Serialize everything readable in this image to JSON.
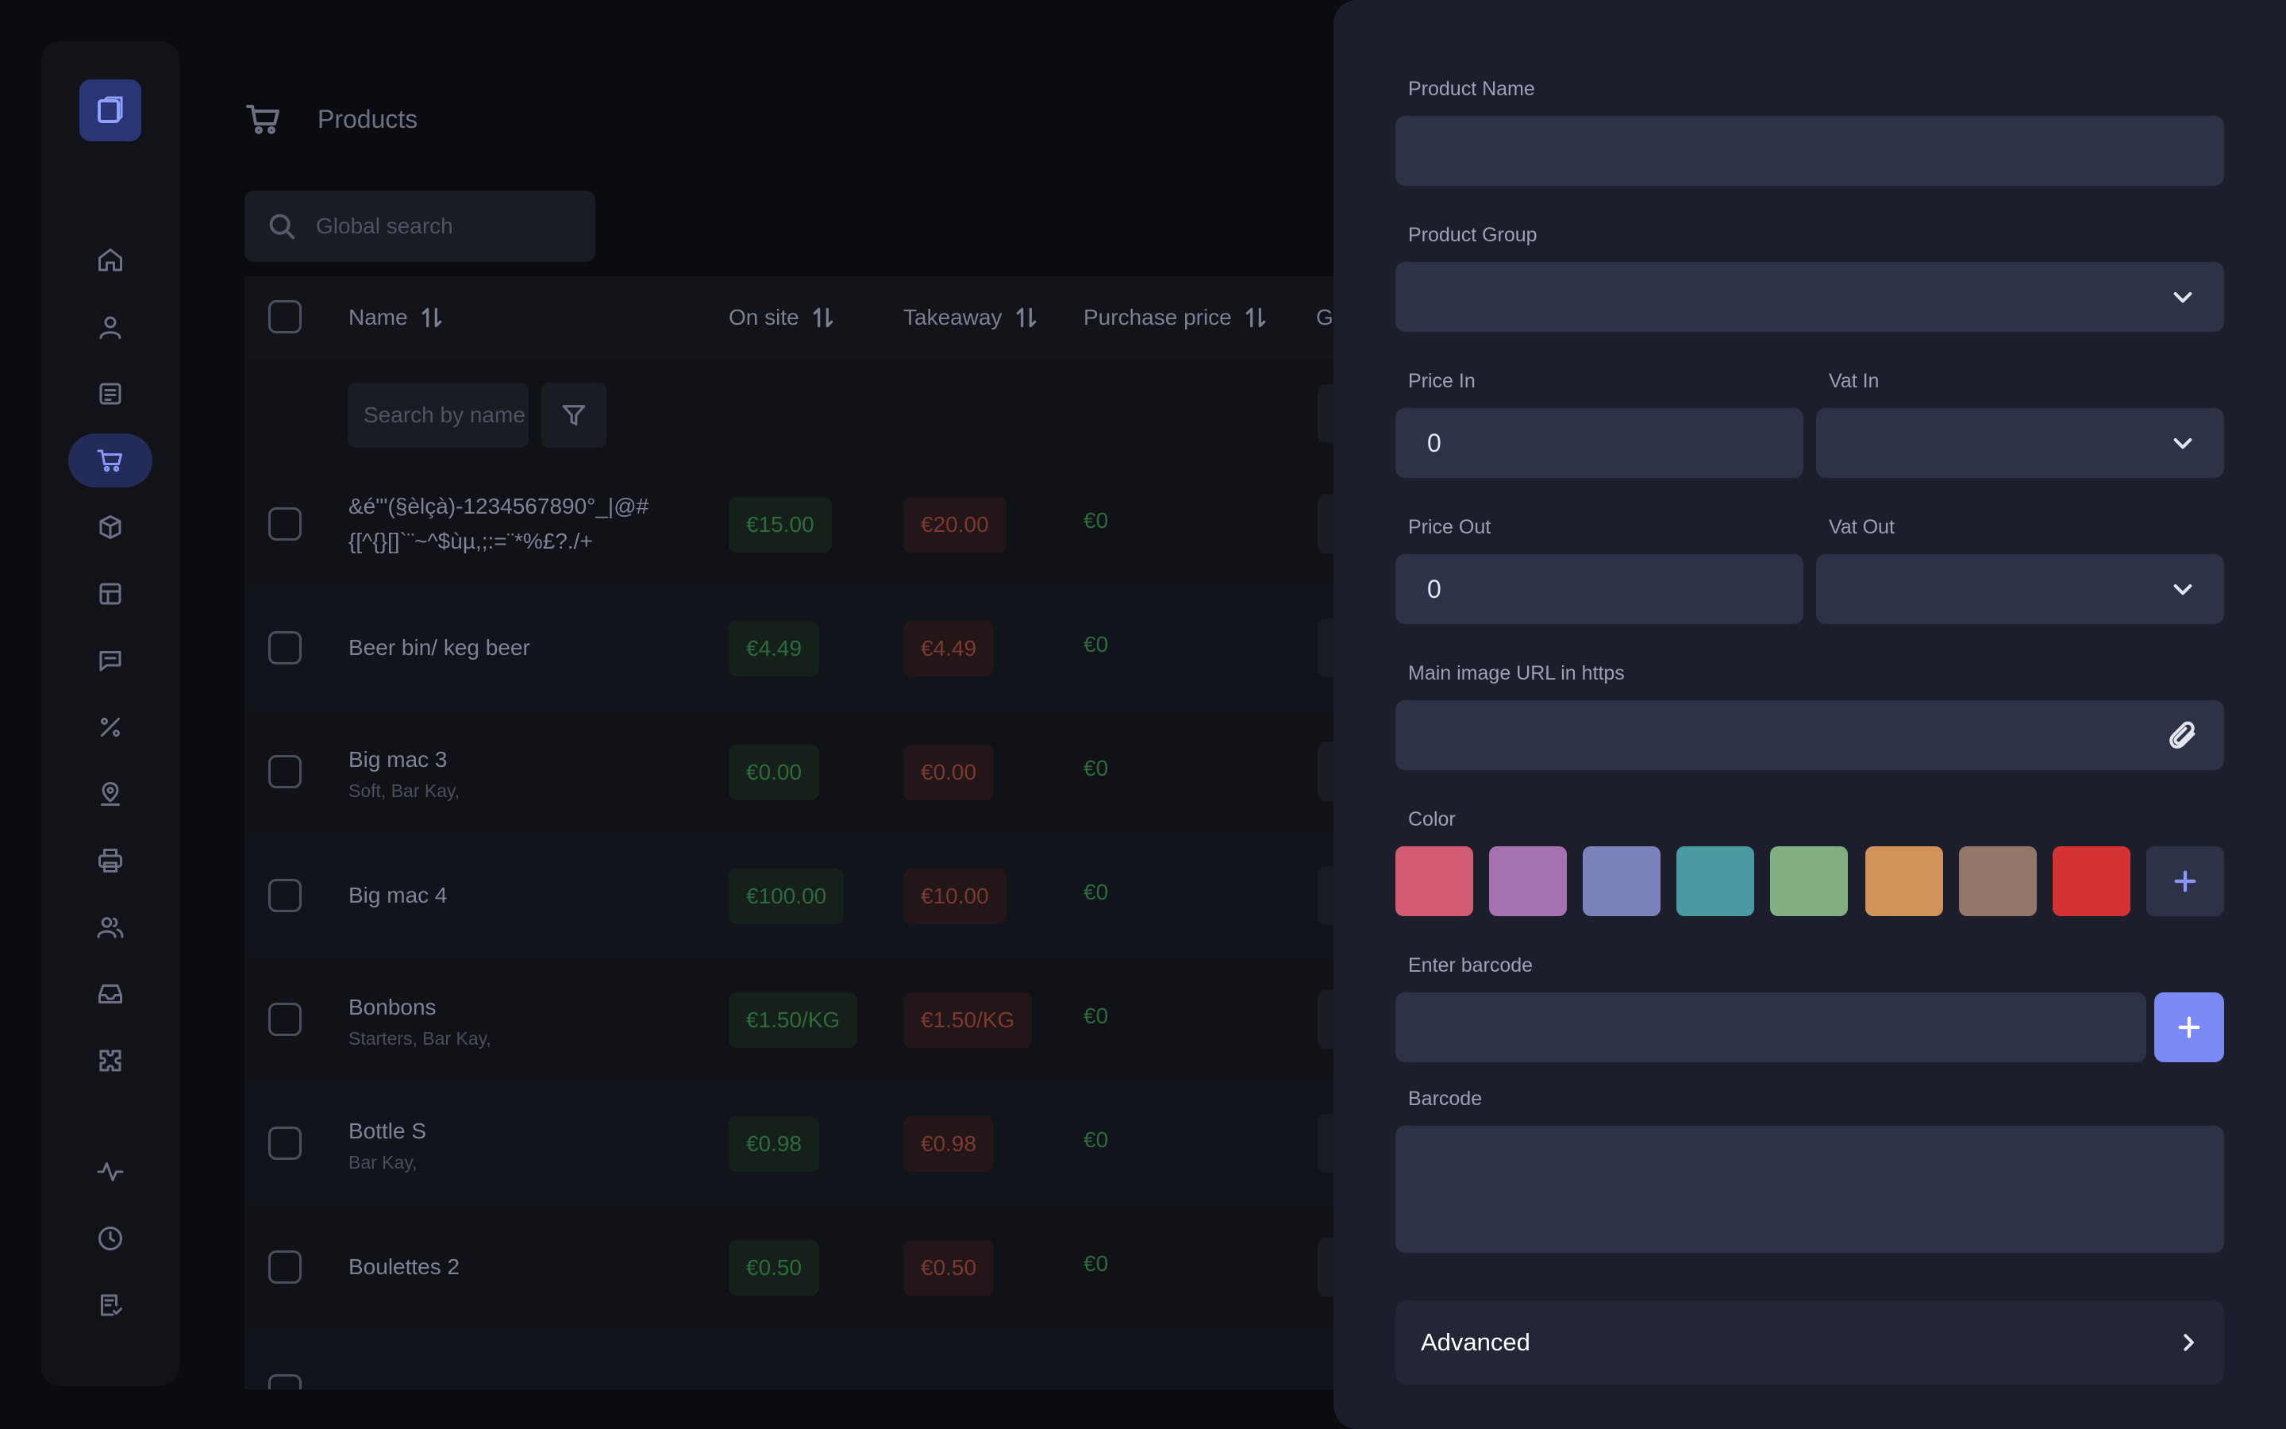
{
  "header": {
    "title": "Products",
    "icon": "cart-icon"
  },
  "search": {
    "placeholder": "Global search"
  },
  "sidebar": {
    "logo": "app-logo",
    "items": [
      {
        "icon": "home-icon",
        "active": false
      },
      {
        "icon": "user-icon",
        "active": false
      },
      {
        "icon": "document-list-icon",
        "active": false
      },
      {
        "icon": "cart-icon",
        "active": true
      },
      {
        "icon": "box-icon",
        "active": false
      },
      {
        "icon": "table-icon",
        "active": false
      },
      {
        "icon": "message-icon",
        "active": false
      },
      {
        "icon": "percent-icon",
        "active": false
      },
      {
        "icon": "location-pin-icon",
        "active": false
      },
      {
        "icon": "printer-icon",
        "active": false
      },
      {
        "icon": "users-icon",
        "active": false
      },
      {
        "icon": "inbox-icon",
        "active": false
      },
      {
        "icon": "puzzle-icon",
        "active": false
      },
      {
        "icon": "activity-icon",
        "active": false
      },
      {
        "icon": "clock-icon",
        "active": false
      },
      {
        "icon": "checklist-icon",
        "active": false
      }
    ]
  },
  "table": {
    "columns": {
      "name": "Name",
      "on_site": "On site",
      "takeaway": "Takeaway",
      "purchase": "Purchase price",
      "group": "G"
    },
    "name_filter_placeholder": "Search by name",
    "rows": [
      {
        "name": "&é\"'(§èlçà)-1234567890°_|@#",
        "name2": "{[^{}[]`¨~^$ùµ,;:=¨*%£?./+",
        "sub": "",
        "on_site": "€15.00",
        "takeaway": "€20.00",
        "purchase": "€0"
      },
      {
        "name": "Beer bin/ keg beer",
        "name2": "",
        "sub": "",
        "on_site": "€4.49",
        "takeaway": "€4.49",
        "purchase": "€0"
      },
      {
        "name": "Big mac 3",
        "name2": "",
        "sub": "Soft, Bar Kay,",
        "on_site": "€0.00",
        "takeaway": "€0.00",
        "purchase": "€0"
      },
      {
        "name": "Big mac 4",
        "name2": "",
        "sub": "",
        "on_site": "€100.00",
        "takeaway": "€10.00",
        "purchase": "€0"
      },
      {
        "name": "Bonbons",
        "name2": "",
        "sub": "Starters, Bar Kay,",
        "on_site": "€1.50/KG",
        "takeaway": "€1.50/KG",
        "purchase": "€0"
      },
      {
        "name": "Bottle S",
        "name2": "",
        "sub": "Bar Kay,",
        "on_site": "€0.98",
        "takeaway": "€0.98",
        "purchase": "€0"
      },
      {
        "name": "Boulettes 2",
        "name2": "",
        "sub": "",
        "on_site": "€0.50",
        "takeaway": "€0.50",
        "purchase": "€0"
      }
    ]
  },
  "form": {
    "product_name_label": "Product Name",
    "product_name_value": "",
    "product_group_label": "Product Group",
    "product_group_value": "",
    "price_in_label": "Price In",
    "price_in_value": "0",
    "vat_in_label": "Vat In",
    "vat_in_value": "",
    "price_out_label": "Price Out",
    "price_out_value": "0",
    "vat_out_label": "Vat Out",
    "vat_out_value": "",
    "image_url_label": "Main image URL in https",
    "image_url_value": "",
    "color_label": "Color",
    "colors": [
      "#d35b73",
      "#a571b0",
      "#7b83ba",
      "#4a9aa1",
      "#82af82",
      "#d29258",
      "#93766a",
      "#d43235"
    ],
    "barcode_input_label": "Enter barcode",
    "barcode_label": "Barcode",
    "advanced_label": "Advanced"
  },
  "colors": {
    "accent": "#7b89f5",
    "drawer_bg": "#1c1f2b",
    "field_bg": "#2d3249"
  }
}
